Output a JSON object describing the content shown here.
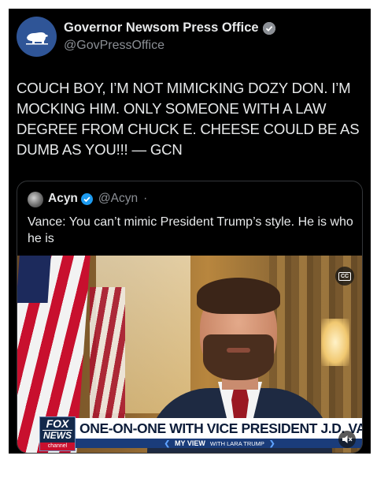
{
  "post": {
    "author_name": "Governor Newsom Press Office",
    "author_handle": "@GovPressOffice",
    "avatar_icon": "california-bear-icon",
    "verified_icon": "verified-badge-icon",
    "text": "COUCH BOY, I’M NOT MIMICKING DOZY DON. I’M MOCKING HIM. ONLY SOMEONE WITH A LAW DEGREE FROM CHUCK E. CHEESE COULD BE AS DUMB AS YOU!!! — GCN"
  },
  "quote": {
    "author_name": "Acyn",
    "author_handle": "@Acyn",
    "separator": "·",
    "verified_color": "#1d9bf0",
    "text": "Vance: You can’t mimic President Trump’s style. He is who he is",
    "video": {
      "cc_label": "CC",
      "network_logo_top": "FOX",
      "network_logo_mid": "NEWS",
      "network_logo_bottom": "channel",
      "headline": "ONE-ON-ONE WITH VICE PRESIDENT J.D. VANCE",
      "strap_show": "MY VIEW",
      "strap_host": "WITH LARA TRUMP",
      "mute_icon": "speaker-muted-icon"
    }
  },
  "colors": {
    "background": "#000000",
    "text_primary": "#e7e9ea",
    "text_secondary": "#8b8f95",
    "avatar_blue": "#2f5597",
    "fox_navy": "#13294b"
  }
}
